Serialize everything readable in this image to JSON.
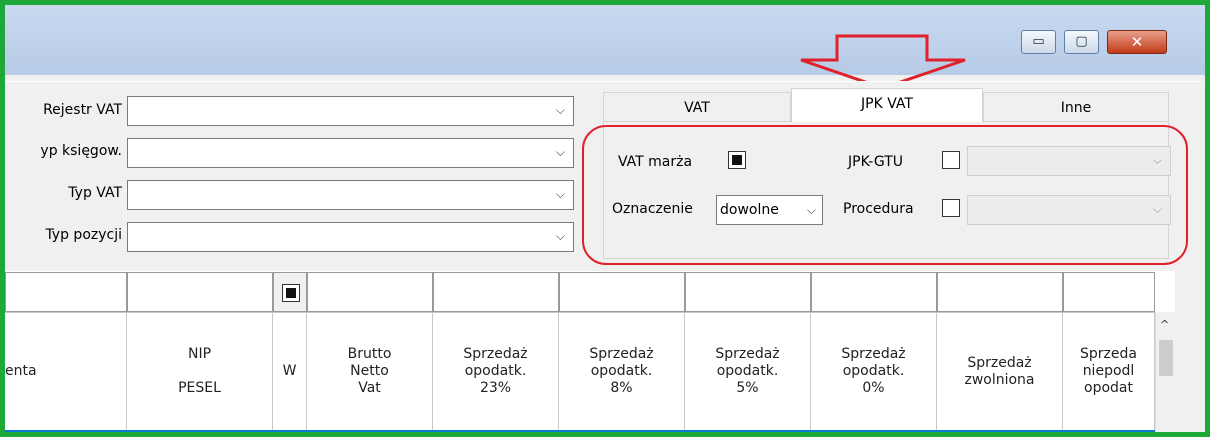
{
  "window_buttons": {
    "minimize": "▭",
    "maximize": "▢",
    "close": "✕"
  },
  "filters": {
    "rejestr_vat": "Rejestr VAT",
    "typ_ksiegow": "yp księgow.",
    "typ_vat": "Typ VAT",
    "typ_pozycji": "Typ pozycji",
    "dropdown_glyph": "⌵"
  },
  "tabs": [
    {
      "label": "VAT"
    },
    {
      "label": "JPK VAT"
    },
    {
      "label": "Inne"
    }
  ],
  "jpk": {
    "vat_marza_label": "VAT marża",
    "vat_marza_checked": true,
    "jpk_gtu_label": "JPK-GTU",
    "oznaczenie_label": "Oznaczenie",
    "oznaczenie_value": "dowolne",
    "procedura_label": "Procedura"
  },
  "columns": [
    {
      "lines": [
        "enta"
      ]
    },
    {
      "lines": [
        "NIP",
        "",
        "PESEL"
      ]
    },
    {
      "lines": [
        "W"
      ]
    },
    {
      "lines": [
        "Brutto",
        "Netto",
        "Vat"
      ]
    },
    {
      "lines": [
        "Sprzedaż",
        "opodatk.",
        "23%"
      ]
    },
    {
      "lines": [
        "Sprzedaż",
        "opodatk.",
        "8%"
      ]
    },
    {
      "lines": [
        "Sprzedaż",
        "opodatk.",
        "5%"
      ]
    },
    {
      "lines": [
        "Sprzedaż",
        "opodatk.",
        "0%"
      ]
    },
    {
      "lines": [
        "Sprzedaż",
        "zwolniona"
      ]
    },
    {
      "lines": [
        "Sprzeda",
        "niepodl",
        "opodat"
      ]
    }
  ],
  "colors": {
    "frame": "#1fa83a",
    "highlight": "#e0202a",
    "selection": "#0a78d7"
  },
  "icons": {
    "scroll_up": "^"
  }
}
